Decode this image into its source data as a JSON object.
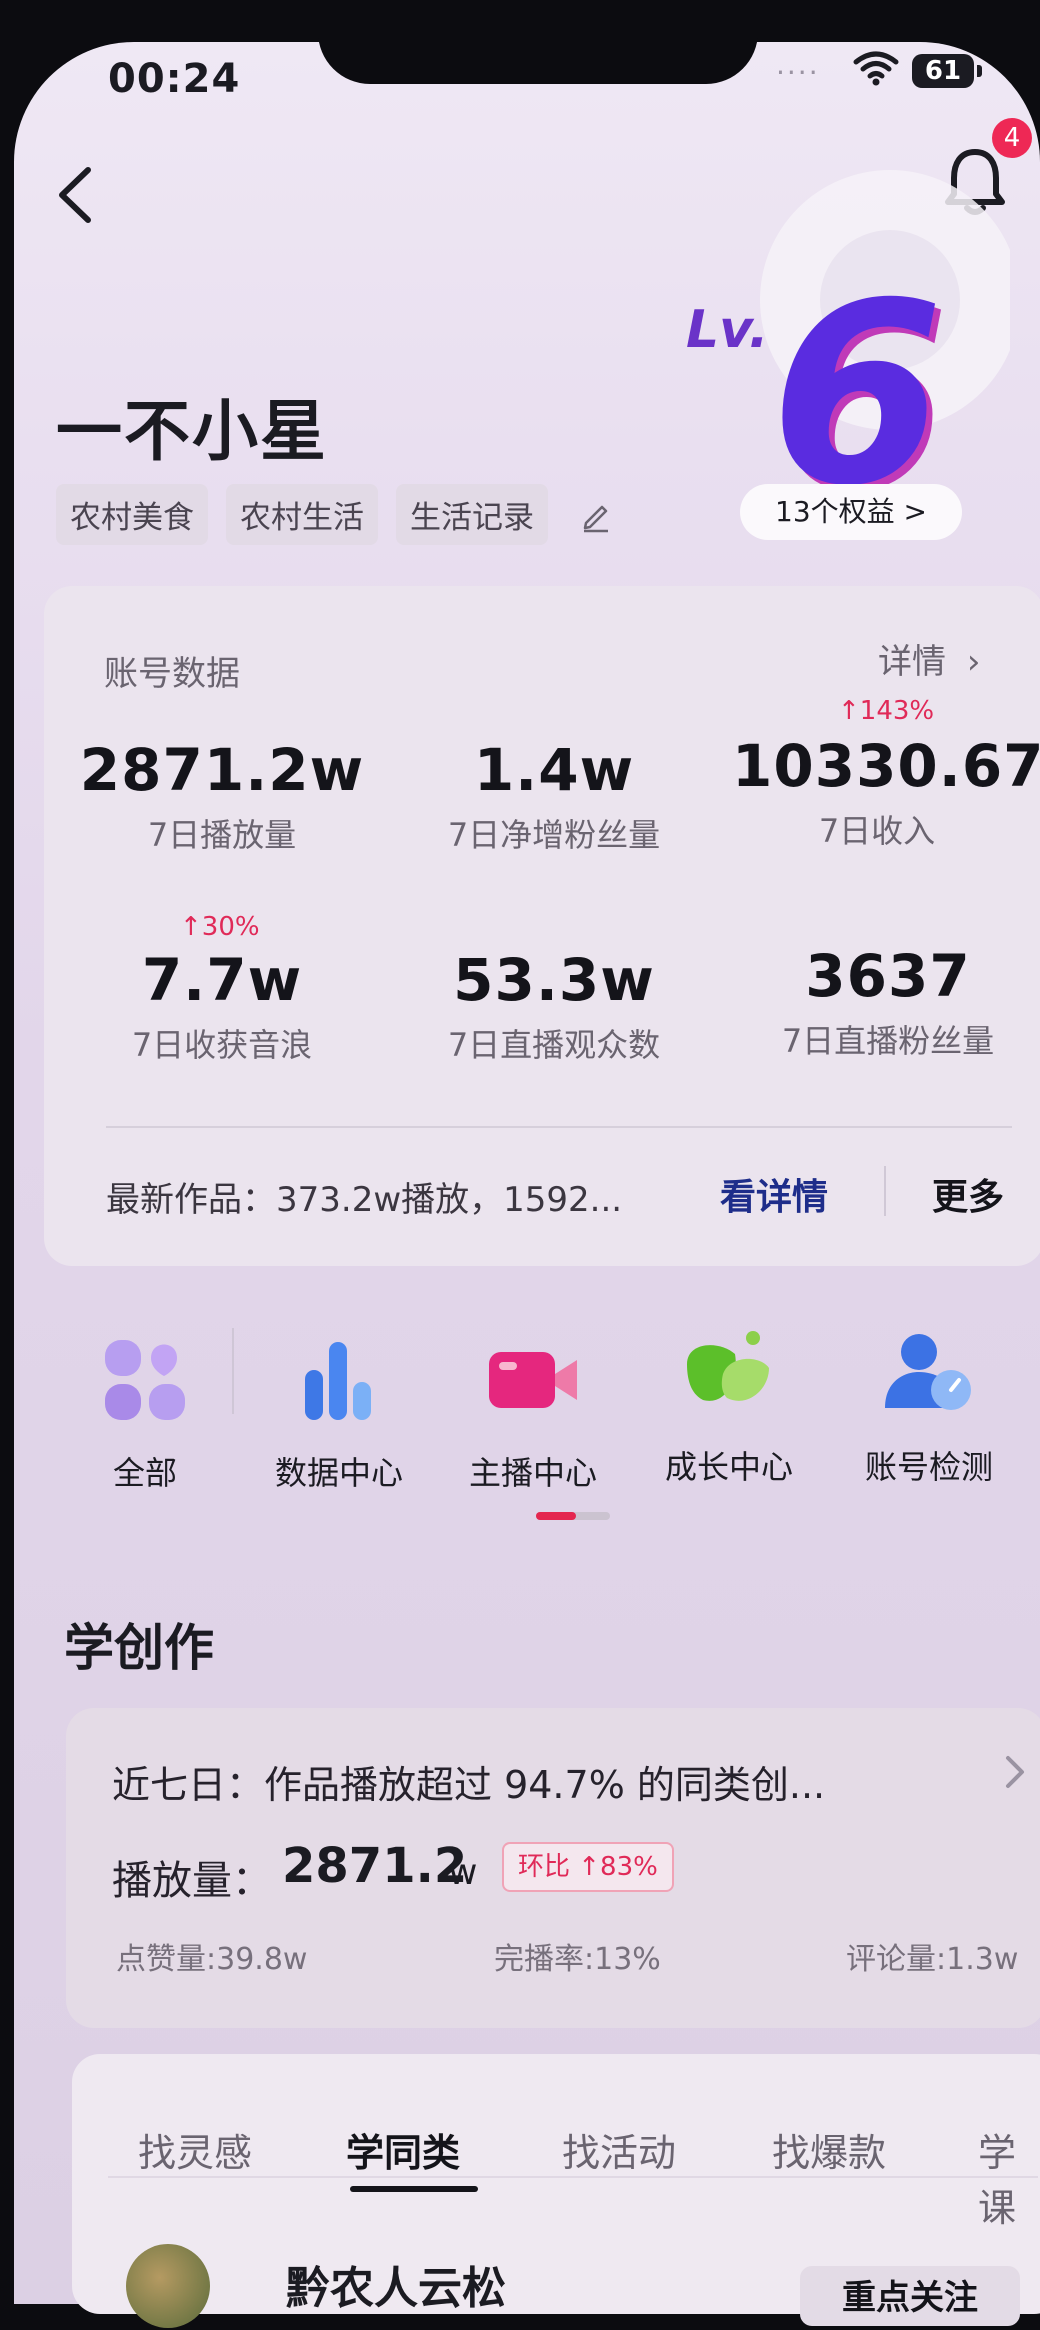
{
  "status_bar": {
    "time": "00:24",
    "signal_dots": "....",
    "battery": "61"
  },
  "header": {
    "notification_count": "4",
    "level_prefix": "Lv.",
    "level_value": "6",
    "rights_label": "13个权益 >"
  },
  "profile": {
    "name": "一不小星",
    "tags": [
      "农村美食",
      "农村生活",
      "生活记录"
    ]
  },
  "account_data": {
    "title": "账号数据",
    "detail_label": "详情",
    "stats": [
      {
        "value": "2871.2w",
        "label": "7日播放量",
        "trend": ""
      },
      {
        "value": "1.4w",
        "label": "7日净增粉丝量",
        "trend": ""
      },
      {
        "value": "10330.67",
        "label": "7日收入",
        "trend": "↑143%"
      },
      {
        "value": "7.7w",
        "label": "7日收获音浪",
        "trend": "↑30%"
      },
      {
        "value": "53.3w",
        "label": "7日直播观众数",
        "trend": ""
      },
      {
        "value": "3637",
        "label": "7日直播粉丝量",
        "trend": ""
      }
    ],
    "latest_work": "最新作品：373.2w播放，1592...",
    "view_detail_label": "看详情",
    "more_label": "更多"
  },
  "tools": [
    {
      "label": "全部",
      "icon": "grid-icon"
    },
    {
      "label": "数据中心",
      "icon": "bar-chart-icon"
    },
    {
      "label": "主播中心",
      "icon": "video-camera-icon"
    },
    {
      "label": "成长中心",
      "icon": "leaf-icon"
    },
    {
      "label": "账号检测",
      "icon": "user-check-icon"
    }
  ],
  "learn": {
    "section_title": "学创作",
    "summary": "近七日：作品播放超过 94.7% 的同类创...",
    "play_label": "播放量：",
    "play_value": "2871.2",
    "play_unit": "w",
    "compare_badge": "环比 ↑83%",
    "likes": "点赞量:39.8w",
    "completion": "完播率:13%",
    "comments": "评论量:1.3w"
  },
  "discover": {
    "tabs": [
      "找灵感",
      "学同类",
      "找活动",
      "找爆款",
      "学课"
    ],
    "active_tab": "学同类",
    "creator_name": "黔农人云松",
    "follow_label": "重点关注"
  },
  "colors": {
    "accent_red": "#e02a58",
    "link_blue": "#1e2d8a",
    "level_purple": "#5a2ce0"
  }
}
